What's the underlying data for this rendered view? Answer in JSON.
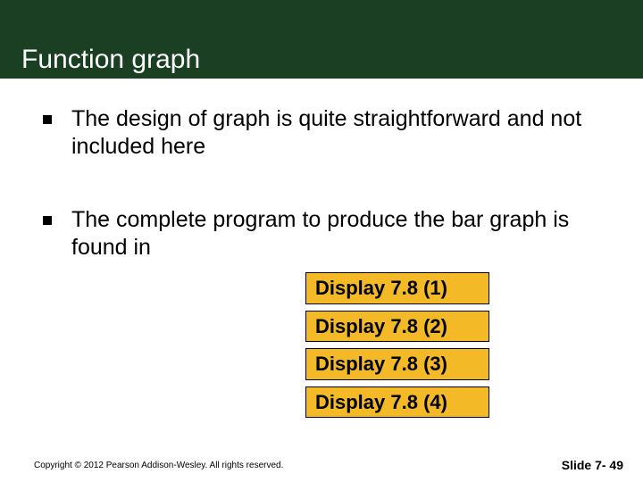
{
  "header": {
    "title": "Function graph"
  },
  "bullets": {
    "item1": "The design of graph is quite straightforward and not included here",
    "item2": "The complete program to produce the bar graph is found in"
  },
  "displays": {
    "d1": "Display 7.8 (1)",
    "d2": "Display 7.8 (2)",
    "d3": "Display 7.8 (3)",
    "d4": "Display 7.8 (4)"
  },
  "footer": {
    "copyright": "Copyright © 2012 Pearson Addison-Wesley.  All rights reserved.",
    "slide": "Slide 7- 49"
  }
}
